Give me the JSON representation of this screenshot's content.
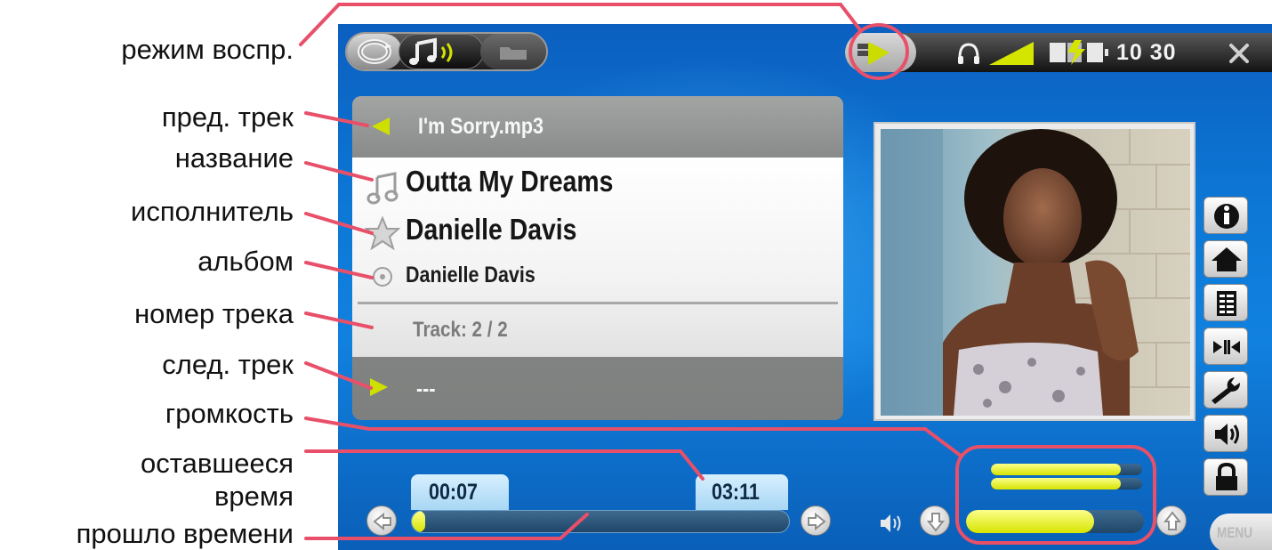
{
  "callouts": {
    "play_mode": "режим воспр.",
    "prev_track": "пред. трек",
    "title": "название",
    "artist": "исполнитель",
    "album": "альбом",
    "track_number": "номер трека",
    "next_track": "след. трек",
    "volume": "громкость",
    "remaining_time_1": "оставшееся",
    "remaining_time_2": "время",
    "elapsed_time": "прошло времени"
  },
  "status": {
    "time": "10 30"
  },
  "track": {
    "previous": "I'm Sorry.mp3",
    "title": "Outta My Dreams",
    "artist": "Danielle Davis",
    "album": "Danielle Davis",
    "track_number": "Track: 2 / 2",
    "next": "---"
  },
  "progress": {
    "elapsed": "00:07",
    "remaining": "03:11",
    "fraction": 0.035
  },
  "volume": {
    "level_left": 0.86,
    "level_right": 0.86,
    "main_level": 0.72
  },
  "menu": {
    "label": "MENU"
  },
  "colors": {
    "accent_yellow": "#e4f000",
    "callout_line": "#e8506a",
    "screen_blue": "#0d78d6"
  },
  "icons": {
    "mode": [
      "repeat-icon",
      "music-note-icon",
      "folder-icon"
    ],
    "status": [
      "play-mode-icon",
      "headphones-icon",
      "signal-wedge-icon",
      "battery-charging-icon",
      "close-icon"
    ],
    "toolbar": [
      "info-icon",
      "home-icon",
      "playlist-icon",
      "ab-repeat-icon",
      "settings-wrench-icon",
      "speaker-icon",
      "lock-icon"
    ]
  }
}
